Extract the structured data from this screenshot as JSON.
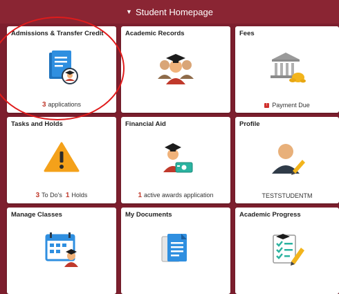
{
  "header": {
    "title": "Student Homepage"
  },
  "tiles": {
    "admissions": {
      "title": "Admissions & Transfer Credit",
      "count": "3",
      "footer": "applications"
    },
    "records": {
      "title": "Academic Records"
    },
    "fees": {
      "title": "Fees",
      "footer": "Payment Due",
      "badge": "!"
    },
    "tasks": {
      "title": "Tasks and Holds",
      "todo_count": "3",
      "todo_label": "To Do's",
      "holds_count": "1",
      "holds_label": "Holds"
    },
    "aid": {
      "title": "Financial Aid",
      "count": "1",
      "footer": "active awards application"
    },
    "profile": {
      "title": "Profile",
      "footer": "TESTSTUDENTM"
    },
    "classes": {
      "title": "Manage Classes"
    },
    "documents": {
      "title": "My Documents"
    },
    "progress": {
      "title": "Academic Progress"
    }
  },
  "icons": {
    "admissions": "document-graduate-icon",
    "records": "students-graduate-icon",
    "fees": "bank-money-icon",
    "tasks": "warning-icon",
    "aid": "student-money-icon",
    "profile": "person-pencil-icon",
    "classes": "calendar-student-icon",
    "documents": "documents-icon",
    "progress": "checklist-pencil-icon"
  },
  "colors": {
    "background": "#7d1f2e",
    "header": "#8a2533",
    "highlight_circle": "#e01b1b",
    "count": "#c0392b"
  }
}
